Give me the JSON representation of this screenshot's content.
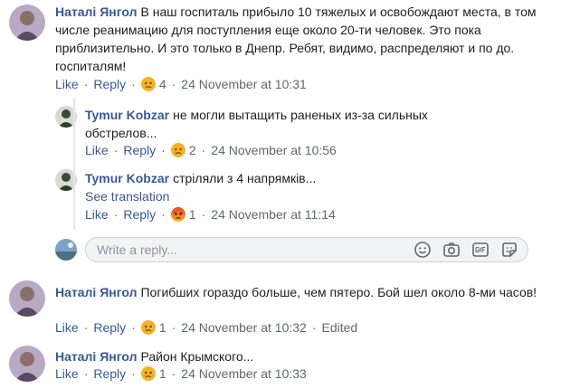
{
  "comments": [
    {
      "author": "Наталі Янгол",
      "text": "В наш госпиталь прибыло 10 тяжелых и освобождают места, в том числе реанимацию для поступления еще около 20-ти человек. Это пока приблизительно. И это только в Днепр. Ребят, видимо, распределяют и по до. госпиталям!",
      "like": "Like",
      "reply": "Reply",
      "reaction_icon": "sad-face-icon",
      "reaction_count": "4",
      "timestamp": "24 November at 10:31"
    },
    {
      "author": "Наталі Янгол",
      "text": "Погибших гораздо больше, чем пятеро. Бой шел около 8-ми часов!",
      "like": "Like",
      "reply": "Reply",
      "reaction_icon": "sad-face-icon",
      "reaction_count": "1",
      "timestamp": "24 November at 10:32",
      "edited": "Edited"
    },
    {
      "author": "Наталі Янгол",
      "text": "Район Крымского...",
      "like": "Like",
      "reply": "Reply",
      "reaction_icon": "sad-face-icon",
      "reaction_count": "1",
      "timestamp": "24 November at 10:33"
    }
  ],
  "replies": [
    {
      "author": "Tymur Kobzar",
      "text": "не могли вытащить раненых из-за сильных обстрелов...",
      "like": "Like",
      "reply": "Reply",
      "reaction_icon": "sad-face-icon",
      "reaction_count": "2",
      "timestamp": "24 November at 10:56"
    },
    {
      "author": "Tymur Kobzar",
      "text": "стріляли з 4 напрямків...",
      "see_translation": "See translation",
      "like": "Like",
      "reply": "Reply",
      "reaction_icon": "angry-face-icon",
      "reaction_count": "1",
      "timestamp": "24 November at 11:14"
    }
  ],
  "composer": {
    "placeholder": "Write a reply...",
    "icons": [
      "emoji-icon",
      "camera-icon",
      "gif-icon",
      "sticker-icon"
    ]
  },
  "colors": {
    "link": "#385898",
    "meta": "#606770",
    "composer_bg": "#f2f3f5",
    "reaction_sad": "#f7b125",
    "reaction_angry": "#e9710f"
  }
}
